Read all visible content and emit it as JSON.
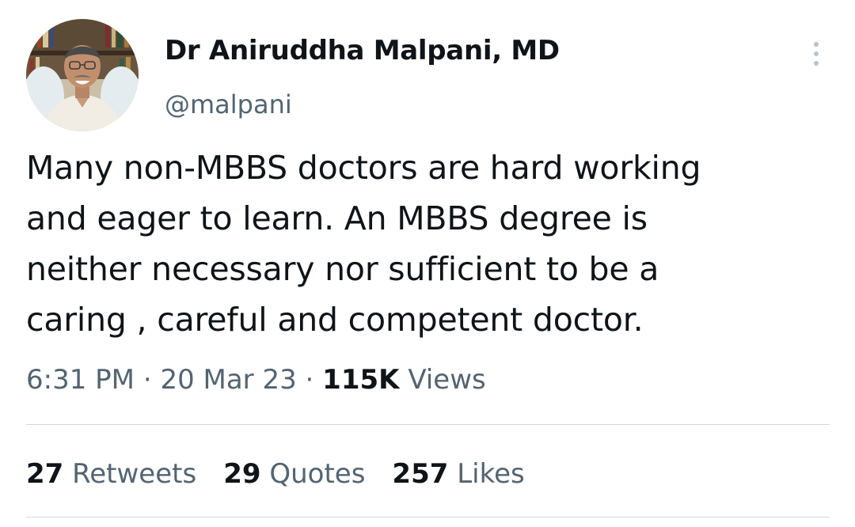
{
  "author": {
    "display_name": "Dr Aniruddha Malpani, MD",
    "handle": "@malpani"
  },
  "tweet": {
    "text_lines": [
      "Many non-MBBS doctors are hard working",
      "and eager to learn. An MBBS degree is",
      "neither necessary nor sufficient to be a",
      "caring , careful and competent doctor."
    ],
    "time": "6:31 PM",
    "separator": "·",
    "date": "20 Mar 23",
    "views_count": "115K",
    "views_label": "Views"
  },
  "stats": {
    "retweets_count": "27",
    "retweets_label": "Retweets",
    "quotes_count": "29",
    "quotes_label": "Quotes",
    "likes_count": "257",
    "likes_label": "Likes"
  },
  "icons": {
    "more": "more-vertical-icon"
  },
  "colors": {
    "text_primary": "#0f1419",
    "text_secondary": "#536471",
    "divider": "#cfd9de"
  }
}
